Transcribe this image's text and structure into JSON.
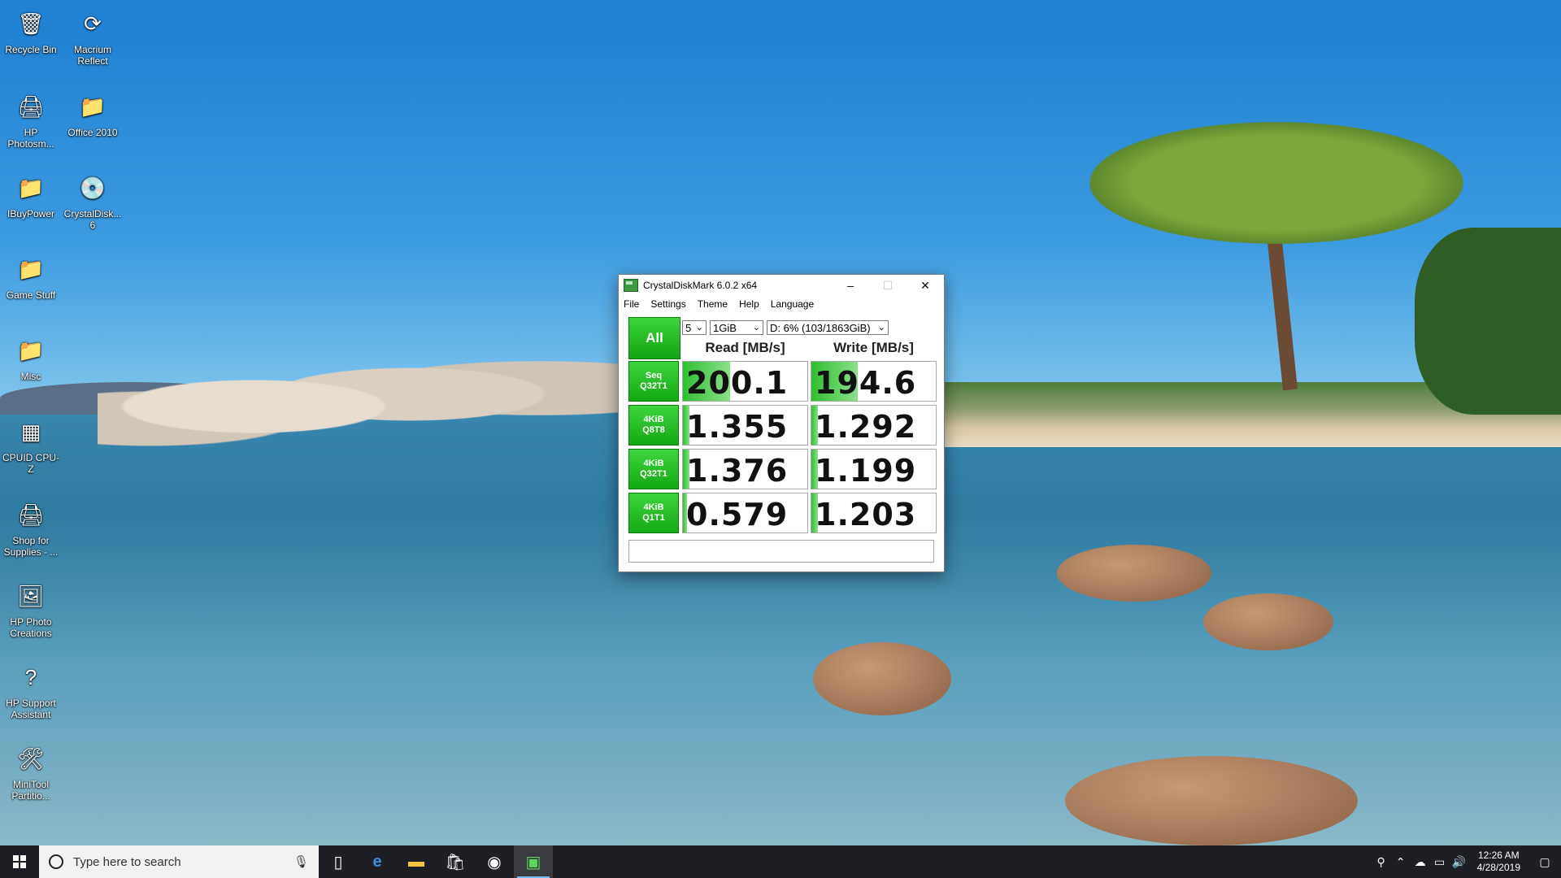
{
  "desktop": {
    "icons": [
      {
        "label": "Recycle Bin",
        "icon": "recycle-bin-icon"
      },
      {
        "label": "Macrium Reflect",
        "icon": "macrium-reflect-icon"
      },
      {
        "label": "HP Photosm...",
        "icon": "hp-photosmart-icon"
      },
      {
        "label": "Office 2010",
        "icon": "office-folder-icon"
      },
      {
        "label": "IBuyPower",
        "icon": "folder-icon"
      },
      {
        "label": "CrystalDisk... 6",
        "icon": "crystaldiskmark-icon"
      },
      {
        "label": "Game Stuff",
        "icon": "folder-icon"
      },
      {
        "label": "Misc",
        "icon": "folder-icon"
      },
      {
        "label": "CPUID CPU-Z",
        "icon": "cpuz-icon"
      },
      {
        "label": "Shop for Supplies - ...",
        "icon": "printer-shop-icon"
      },
      {
        "label": "HP Photo Creations",
        "icon": "hp-photo-creations-icon"
      },
      {
        "label": "HP Support Assistant",
        "icon": "help-icon"
      },
      {
        "label": "MiniTool Partitio...",
        "icon": "minitool-partition-icon"
      }
    ]
  },
  "window": {
    "title": "CrystalDiskMark 6.0.2 x64",
    "controls": {
      "minimize": "–",
      "maximize": "☐",
      "close": "✕"
    },
    "menu": [
      "File",
      "Settings",
      "Theme",
      "Help",
      "Language"
    ],
    "all_button": "All",
    "count_select": "5",
    "size_select": "1GiB",
    "drive_select": "D: 6% (103/1863GiB)",
    "read_header": "Read [MB/s]",
    "write_header": "Write [MB/s]",
    "rows": [
      {
        "line1": "Seq",
        "line2": "Q32T1",
        "read": "200.1",
        "write": "194.6",
        "read_fill": 0.38,
        "write_fill": 0.37
      },
      {
        "line1": "4KiB",
        "line2": "Q8T8",
        "read": "1.355",
        "write": "1.292",
        "read_fill": 0.05,
        "write_fill": 0.05
      },
      {
        "line1": "4KiB",
        "line2": "Q32T1",
        "read": "1.376",
        "write": "1.199",
        "read_fill": 0.05,
        "write_fill": 0.05
      },
      {
        "line1": "4KiB",
        "line2": "Q1T1",
        "read": "0.579",
        "write": "1.203",
        "read_fill": 0.03,
        "write_fill": 0.05
      }
    ],
    "comment": ""
  },
  "taskbar": {
    "search_placeholder": "Type here to search",
    "apps": [
      "task-view-icon",
      "edge-icon",
      "file-explorer-icon",
      "store-icon",
      "chrome-icon",
      "crystaldiskmark-icon"
    ],
    "time": "12:26 AM",
    "date": "4/28/2019"
  },
  "colors": {
    "accent_green": "#12a412",
    "taskbar": "#1e1f24"
  }
}
